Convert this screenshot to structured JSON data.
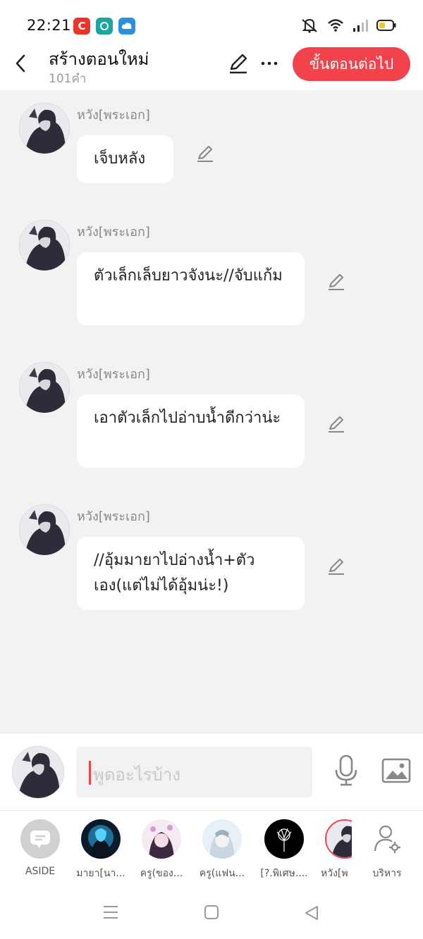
{
  "status": {
    "time": "22:21"
  },
  "header": {
    "title": "สร้างตอนใหม่",
    "word_count": "101คำ",
    "next_button": "ขั้นตอนต่อไป"
  },
  "messages": [
    {
      "speaker": "หวัง[พระเอก]",
      "text": "เจ็บหลัง"
    },
    {
      "speaker": "หวัง[พระเอก]",
      "text": "ตัวเล็กเล็บยาวจังนะ//จับแก้ม"
    },
    {
      "speaker": "หวัง[พระเอก]",
      "text": "เอาตัวเล็กไปอ่าบน้ำดีกว่าน่ะ"
    },
    {
      "speaker": "หวัง[พระเอก]",
      "text": "//อุ้มมายาไปอ่างน้ำ+ตัวเอง(แต่ไม่ได้อุ้มน่ะ!)"
    }
  ],
  "composer": {
    "placeholder": "พูดอะไรบ้าง"
  },
  "characters": [
    {
      "label": "ASIDE"
    },
    {
      "label": "มายา[นา..."
    },
    {
      "label": "ครู(ของ..."
    },
    {
      "label": "ครู(แฟน..."
    },
    {
      "label": "[?.พิเศษ...."
    },
    {
      "label": "หวัง[พ"
    },
    {
      "label": "บริหาร"
    }
  ],
  "colors": {
    "accent": "#f2424c",
    "background": "#f2f2f2"
  }
}
